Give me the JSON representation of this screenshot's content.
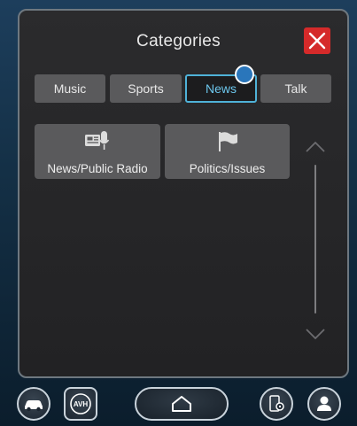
{
  "header": {
    "title": "Categories",
    "close_icon": "close-x-icon",
    "close_color": "#d52a2a"
  },
  "tabs": [
    {
      "label": "Music",
      "active": false
    },
    {
      "label": "Sports",
      "active": false
    },
    {
      "label": "News",
      "active": true
    },
    {
      "label": "Talk",
      "active": false
    }
  ],
  "categories": [
    {
      "label": "News/Public Radio",
      "icon": "newspaper-microphone-icon"
    },
    {
      "label": "Politics/Issues",
      "icon": "flag-icon"
    }
  ],
  "scroll": {
    "up_icon": "chevron-up-icon",
    "down_icon": "chevron-down-icon"
  },
  "footer": {
    "car_icon": "car-icon",
    "avh_label": "AVH",
    "home_icon": "home-icon",
    "phone_settings_icon": "phone-settings-icon",
    "profile_icon": "person-icon"
  },
  "colors": {
    "accent": "#4fb2d8",
    "tab_bg": "#5a5a5c",
    "panel_bg": "#2b2b2d"
  }
}
